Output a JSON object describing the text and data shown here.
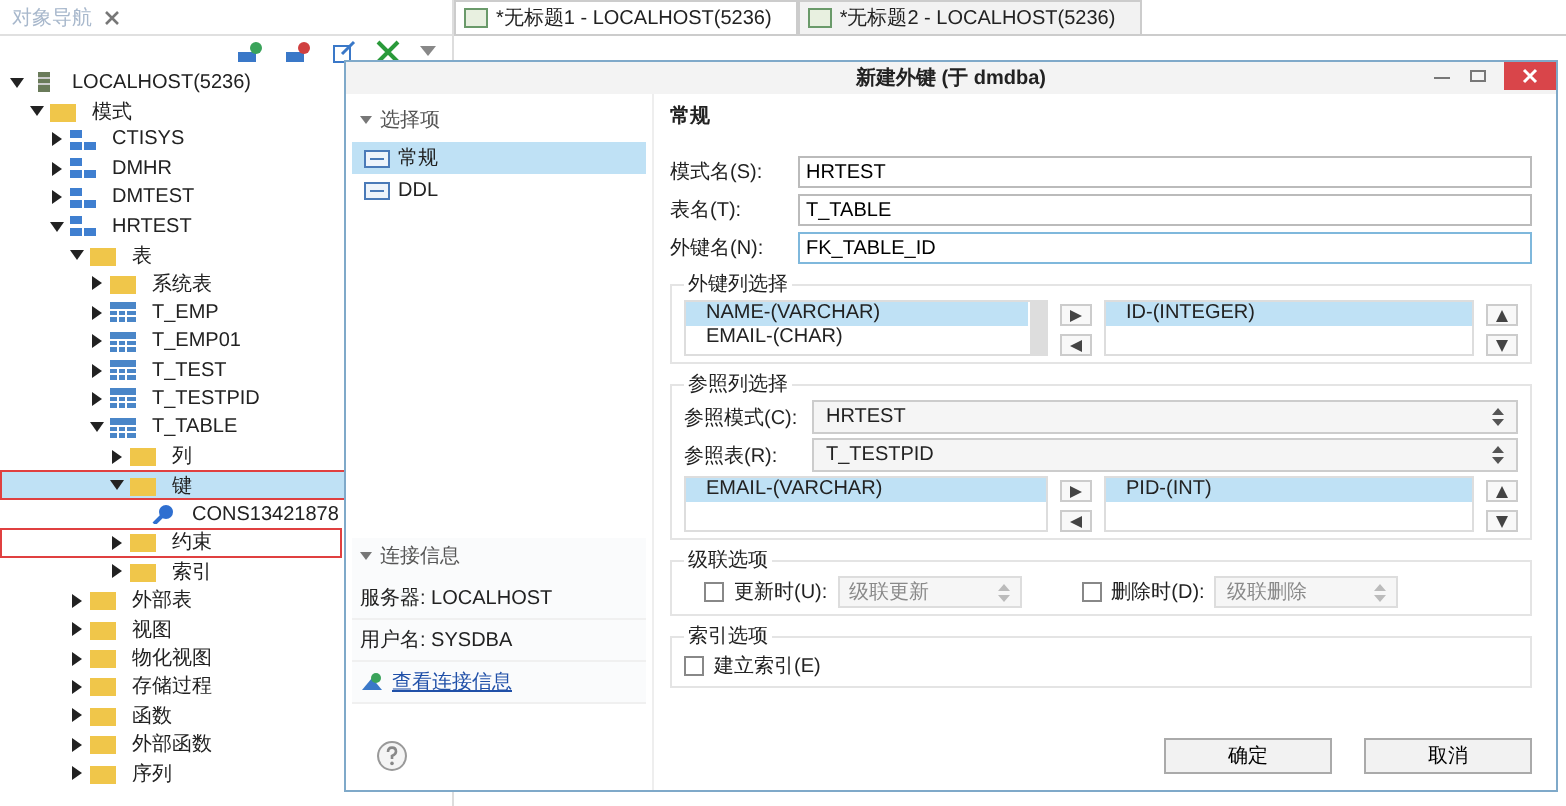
{
  "navigator": {
    "tab_label": "对象导航",
    "tree": [
      {
        "label": "LOCALHOST(5236)",
        "kind": "server",
        "expanded": true,
        "selected": false,
        "annotated": false,
        "children": [
          {
            "label": "模式",
            "kind": "folder",
            "expanded": true,
            "selected": false,
            "annotated": false,
            "children": [
              {
                "label": "CTISYS",
                "kind": "schema",
                "expanded": false,
                "selected": false,
                "annotated": false
              },
              {
                "label": "DMHR",
                "kind": "schema",
                "expanded": false,
                "selected": false,
                "annotated": false
              },
              {
                "label": "DMTEST",
                "kind": "schema",
                "expanded": false,
                "selected": false,
                "annotated": false
              },
              {
                "label": "HRTEST",
                "kind": "schema",
                "expanded": true,
                "selected": false,
                "annotated": false,
                "children": [
                  {
                    "label": "表",
                    "kind": "folder",
                    "expanded": true,
                    "selected": false,
                    "annotated": false,
                    "children": [
                      {
                        "label": "系统表",
                        "kind": "folder",
                        "expanded": false,
                        "selected": false,
                        "annotated": false
                      },
                      {
                        "label": "T_EMP",
                        "kind": "table",
                        "expanded": false,
                        "selected": false,
                        "annotated": false
                      },
                      {
                        "label": "T_EMP01",
                        "kind": "table",
                        "expanded": false,
                        "selected": false,
                        "annotated": false
                      },
                      {
                        "label": "T_TEST",
                        "kind": "table",
                        "expanded": false,
                        "selected": false,
                        "annotated": false
                      },
                      {
                        "label": "T_TESTPID",
                        "kind": "table",
                        "expanded": false,
                        "selected": false,
                        "annotated": false
                      },
                      {
                        "label": "T_TABLE",
                        "kind": "table",
                        "expanded": true,
                        "selected": false,
                        "annotated": false,
                        "children": [
                          {
                            "label": "列",
                            "kind": "folder",
                            "expanded": false,
                            "selected": false,
                            "annotated": false
                          },
                          {
                            "label": "键",
                            "kind": "folder",
                            "expanded": true,
                            "selected": true,
                            "annotated": true,
                            "children": [
                              {
                                "label": "CONS13421878",
                                "kind": "key",
                                "selected": false,
                                "annotated": false
                              }
                            ]
                          },
                          {
                            "label": "约束",
                            "kind": "folder",
                            "expanded": false,
                            "selected": false,
                            "annotated": true
                          },
                          {
                            "label": "索引",
                            "kind": "folder",
                            "expanded": false,
                            "selected": false,
                            "annotated": false
                          }
                        ]
                      }
                    ]
                  },
                  {
                    "label": "外部表",
                    "kind": "folder",
                    "expanded": false,
                    "selected": false,
                    "annotated": false
                  },
                  {
                    "label": "视图",
                    "kind": "folder",
                    "expanded": false,
                    "selected": false,
                    "annotated": false
                  },
                  {
                    "label": "物化视图",
                    "kind": "folder",
                    "expanded": false,
                    "selected": false,
                    "annotated": false
                  },
                  {
                    "label": "存储过程",
                    "kind": "folder",
                    "expanded": false,
                    "selected": false,
                    "annotated": false
                  },
                  {
                    "label": "函数",
                    "kind": "folder",
                    "expanded": false,
                    "selected": false,
                    "annotated": false
                  },
                  {
                    "label": "外部函数",
                    "kind": "folder",
                    "expanded": false,
                    "selected": false,
                    "annotated": false
                  },
                  {
                    "label": "序列",
                    "kind": "folder",
                    "expanded": false,
                    "selected": false,
                    "annotated": false
                  }
                ]
              }
            ]
          }
        ]
      }
    ]
  },
  "editor_tabs": [
    {
      "label": "*无标题1 - LOCALHOST(5236)",
      "selected": true
    },
    {
      "label": "*无标题2 - LOCALHOST(5236)",
      "selected": false
    }
  ],
  "dialog": {
    "title": "新建外键 (于 dmdba)",
    "nav_section": "选择项",
    "nav_items": [
      {
        "label": "常规",
        "selected": true
      },
      {
        "label": "DDL",
        "selected": false
      }
    ],
    "connection": {
      "heading": "连接信息",
      "server": "服务器: LOCALHOST",
      "user": "用户名: SYSDBA",
      "link": "查看连接信息"
    },
    "page_title": "常规",
    "fields": [
      {
        "label": "模式名(S):",
        "value": "HRTEST",
        "focused": false
      },
      {
        "label": "表名(T):",
        "value": "T_TABLE",
        "focused": false
      },
      {
        "label": "外键名(N):",
        "value": "FK_TABLE_ID",
        "focused": true
      }
    ],
    "fk_columns": {
      "heading": "外键列选择",
      "available": [
        {
          "label": "NAME-(VARCHAR)",
          "selected": true
        },
        {
          "label": "EMAIL-(CHAR)",
          "selected": false
        }
      ],
      "chosen": [
        {
          "label": "ID-(INTEGER)",
          "selected": true
        }
      ]
    },
    "reference": {
      "heading": "参照列选择",
      "selects": [
        {
          "label": "参照模式(C):",
          "value": "HRTEST"
        },
        {
          "label": "参照表(R):",
          "value": "T_TESTPID"
        }
      ],
      "available": [
        {
          "label": "EMAIL-(VARCHAR)",
          "selected": true
        }
      ],
      "chosen": [
        {
          "label": "PID-(INT)",
          "selected": true
        }
      ]
    },
    "cascade": {
      "heading": "级联选项",
      "options": [
        {
          "label": "更新时(U):",
          "checked": false,
          "value": "级联更新",
          "disabled": true
        },
        {
          "label": "删除时(D):",
          "checked": false,
          "value": "级联删除",
          "disabled": true
        }
      ]
    },
    "index": {
      "heading": "索引选项",
      "options": [
        {
          "label": "建立索引(E)",
          "checked": false
        }
      ]
    },
    "buttons": [
      "确定",
      "取消"
    ]
  }
}
